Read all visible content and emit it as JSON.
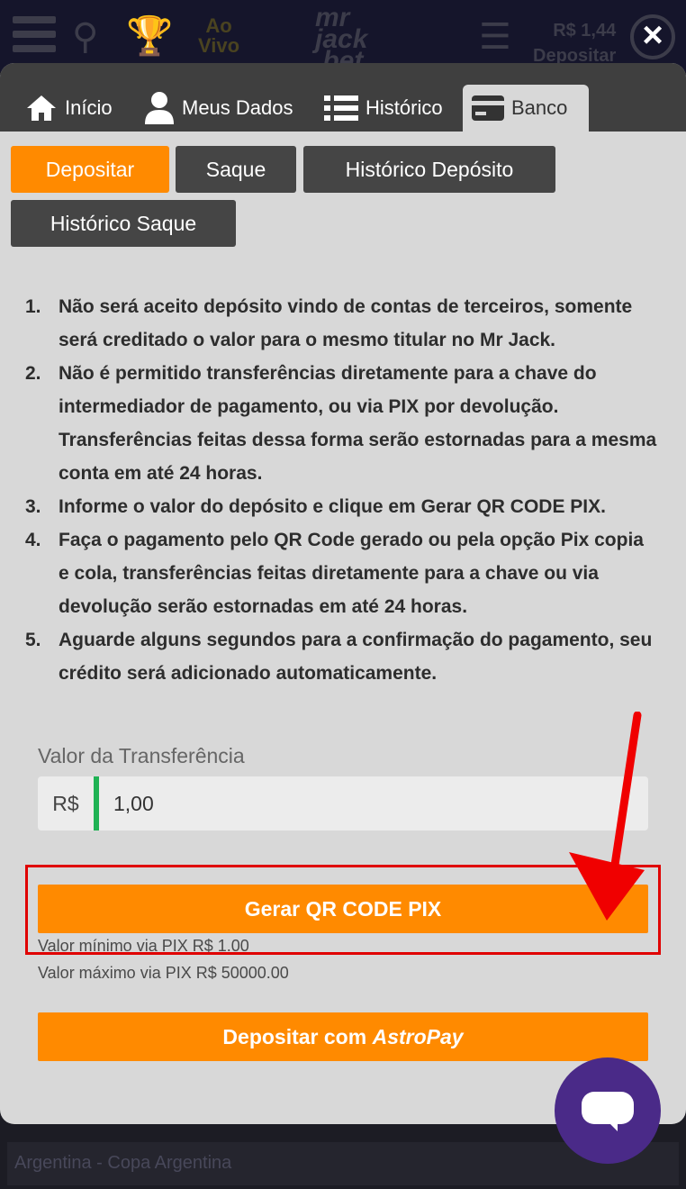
{
  "topbar": {
    "aovivo_line1": "Ao",
    "aovivo_line2": "Vivo",
    "logo_line1": "mr",
    "logo_line2": "jack",
    "logo_line3": ".bet",
    "balance": "R$ 1,44",
    "deposit": "Depositar"
  },
  "close_label": "×",
  "tabs": [
    {
      "label": "Início",
      "icon": "home-icon"
    },
    {
      "label": "Meus Dados",
      "icon": "user-icon"
    },
    {
      "label": "Histórico",
      "icon": "list-icon"
    },
    {
      "label": "Banco",
      "icon": "card-icon"
    }
  ],
  "subtabs": [
    "Depositar",
    "Saque",
    "Histórico Depósito",
    "Histórico Saque"
  ],
  "instructions": [
    {
      "num": "1.",
      "text": "Não será aceito depósito vindo de contas de terceiros, somente será creditado o valor para o mesmo titular no Mr Jack."
    },
    {
      "num": "2.",
      "text": "Não é permitido transferências diretamente para a chave do intermediador de pagamento, ou via PIX por devolução. Transferências feitas dessa forma serão estornadas para a mesma conta em até 24 horas."
    },
    {
      "num": "3.",
      "text": "Informe o valor do depósito e clique em Gerar QR CODE PIX."
    },
    {
      "num": "4.",
      "text": "Faça o pagamento pelo QR Code gerado ou pela opção Pix copia e cola, transferências feitas diretamente para a chave ou via devolução serão estornadas em até 24 horas."
    },
    {
      "num": "5.",
      "text": "Aguarde alguns segundos para a confirmação do pagamento, seu crédito será adicionado automaticamente."
    }
  ],
  "form": {
    "label": "Valor da Transferência",
    "prefix": "R$",
    "value": "1,00"
  },
  "buttons": {
    "qr": "Gerar QR CODE PIX",
    "astro_prefix": "Depositar com",
    "astro_brand": "AstroPay"
  },
  "limits": {
    "min": "Valor mínimo via PIX R$ 1.00",
    "max": "Valor máximo via PIX R$ 50000.00"
  },
  "bottom_strip": "Argentina - Copa Argentina",
  "colors": {
    "accent": "#ff8a00",
    "highlight": "#e00000",
    "chat": "#4a2a88"
  }
}
